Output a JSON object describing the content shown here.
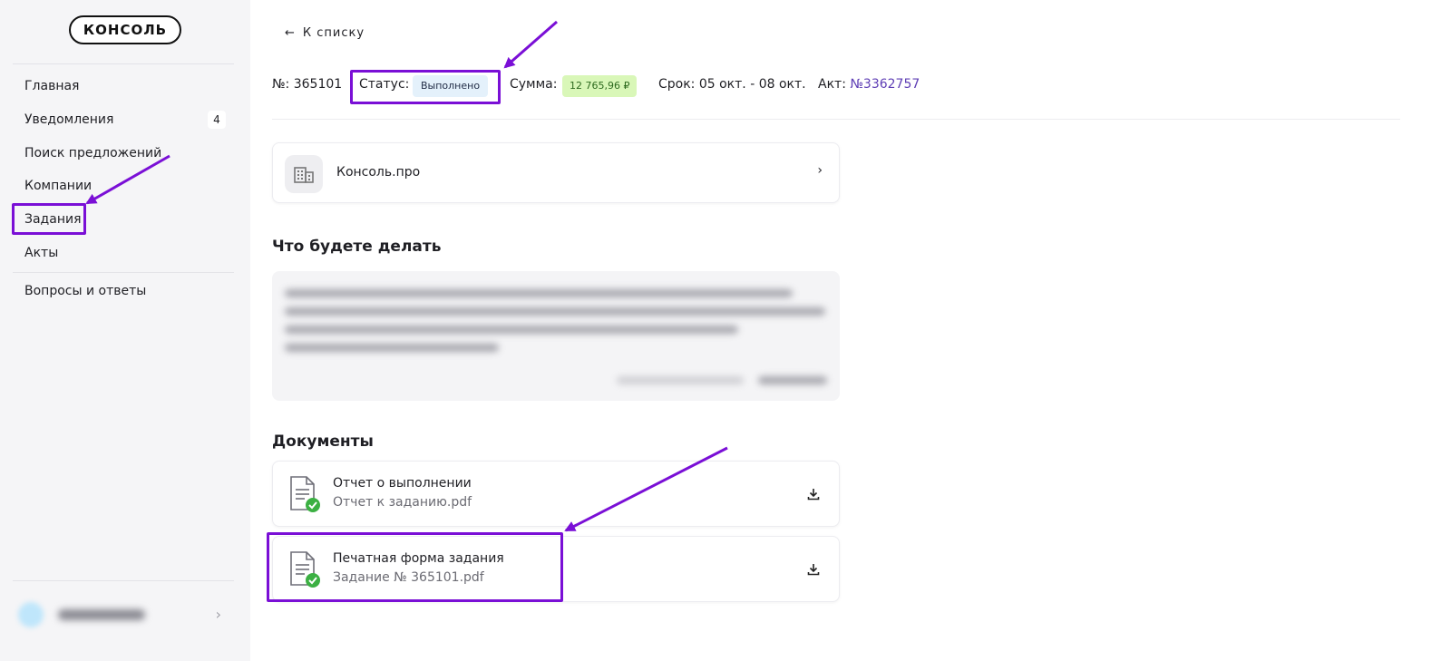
{
  "sidebar": {
    "logo": "КОНСОЛЬ",
    "items": [
      {
        "label": "Главная"
      },
      {
        "label": "Уведомления",
        "badge": "4"
      },
      {
        "label": "Поиск предложений"
      },
      {
        "label": "Компании"
      },
      {
        "label": "Задания",
        "active": true
      },
      {
        "label": "Акты"
      },
      {
        "label": "Вопросы и ответы"
      }
    ],
    "user_chevron": "›"
  },
  "header": {
    "back_arrow": "←",
    "back_label": "К списку",
    "number": "№: 365101",
    "status_label": "Статус:",
    "status_value": "Выполнено",
    "sum_label": "Сумма:",
    "sum_value": "12 765,96 ₽",
    "term": "Срок: 05 окт. - 08 окт.",
    "act_label": "Акт:",
    "act_value": "№3362757"
  },
  "company": {
    "name": "Консоль.про",
    "chevron": "›"
  },
  "task_section": {
    "title": "Что будете делать"
  },
  "documents": {
    "title": "Документы",
    "items": [
      {
        "title": "Отчет о выполнении",
        "file": "Отчет к заданию.pdf"
      },
      {
        "title": "Печатная форма задания",
        "file": "Задание № 365101.pdf"
      }
    ]
  },
  "colors": {
    "annotation": "#7a0fd6",
    "status_badge_bg": "#e4f1fb",
    "sum_badge_bg": "#d9f7b8",
    "act_link": "#5f3fb5",
    "success_check": "#3cb043"
  },
  "icons": [
    "arrow-left-icon",
    "building-icon",
    "chevron-right-icon",
    "document-check-icon",
    "download-icon"
  ]
}
